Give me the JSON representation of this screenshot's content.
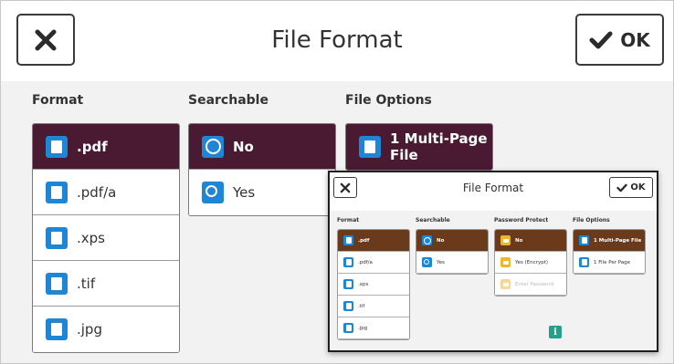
{
  "header": {
    "title": "File Format",
    "ok_label": "OK"
  },
  "columns": {
    "format": {
      "label": "Format",
      "items": [
        ".pdf",
        ".pdf/a",
        ".xps",
        ".tif",
        ".jpg"
      ],
      "selected": 0
    },
    "searchable": {
      "label": "Searchable",
      "items": [
        "No",
        "Yes"
      ],
      "selected": 0
    },
    "file_options": {
      "label": "File Options",
      "items": [
        "1 Multi-Page File"
      ],
      "selected": 0
    }
  },
  "inset": {
    "title": "File Format",
    "ok_label": "OK",
    "format": {
      "label": "Format",
      "items": [
        ".pdf",
        ".pdf/a",
        ".xps",
        ".tif",
        ".jpg"
      ]
    },
    "searchable": {
      "label": "Searchable",
      "items": [
        "No",
        "Yes"
      ]
    },
    "password_protect": {
      "label": "Password Protect",
      "items": [
        "No",
        "Yes (Encrypt)",
        "Enter Password"
      ]
    },
    "file_options": {
      "label": "File Options",
      "items": [
        "1 Multi-Page File",
        "1 File Per Page"
      ]
    },
    "info_glyph": "i"
  },
  "colors": {
    "selected_bg": "#4a1a33",
    "inset_selected_bg": "#6b3a1a",
    "icon_blue": "#1f86d6",
    "icon_gold": "#f0b530",
    "info_teal": "#24a08a"
  },
  "icons": {
    "close": "close-icon",
    "ok": "checkmark-icon",
    "format": "document-icon",
    "no": "no-symbol-icon",
    "yes": "search-icon",
    "file_options": "multi-page-icon",
    "password": "lock-icon",
    "info": "info-icon"
  }
}
